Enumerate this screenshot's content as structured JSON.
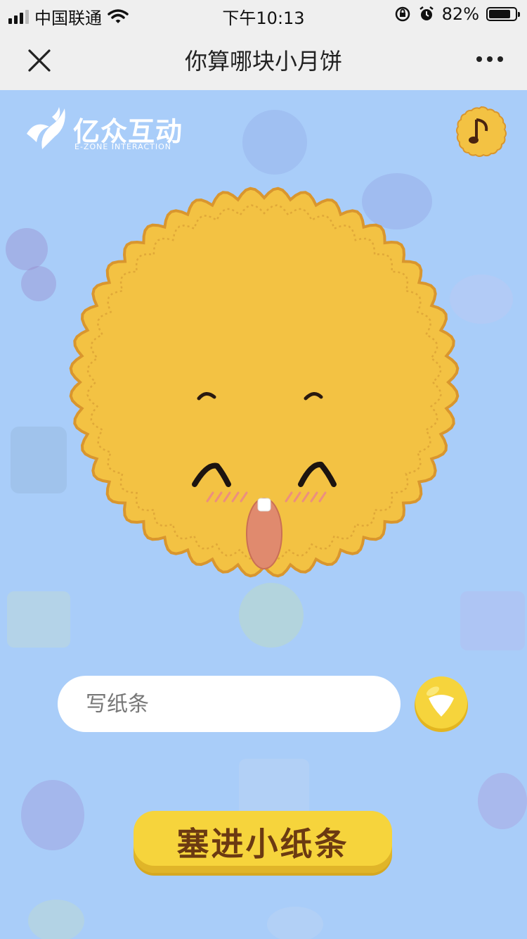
{
  "status_bar": {
    "carrier": "中国联通",
    "time": "下午10:13",
    "battery_percent": "82%",
    "battery_level": 0.82,
    "icons": [
      "signal-icon",
      "wifi-icon",
      "rotation-lock-icon",
      "alarm-icon",
      "battery-icon"
    ]
  },
  "nav": {
    "title": "你算哪块小月饼",
    "close_icon": "close-icon",
    "more_icon": "more-icon"
  },
  "brand": {
    "name": "亿众互动",
    "subtitle": "E-ZONE INTERACTION"
  },
  "music_button": {
    "icon": "music-note-icon"
  },
  "note": {
    "placeholder": "写纸条",
    "value": ""
  },
  "select_button": {
    "icon": "chevron-down-icon"
  },
  "submit": {
    "label": "塞进小纸条"
  },
  "colors": {
    "background": "#a9cdf9",
    "mooncake": "#f3c243",
    "mooncake_edge": "#d9962e",
    "button": "#f6d43c",
    "button_text": "#6b3a12"
  }
}
